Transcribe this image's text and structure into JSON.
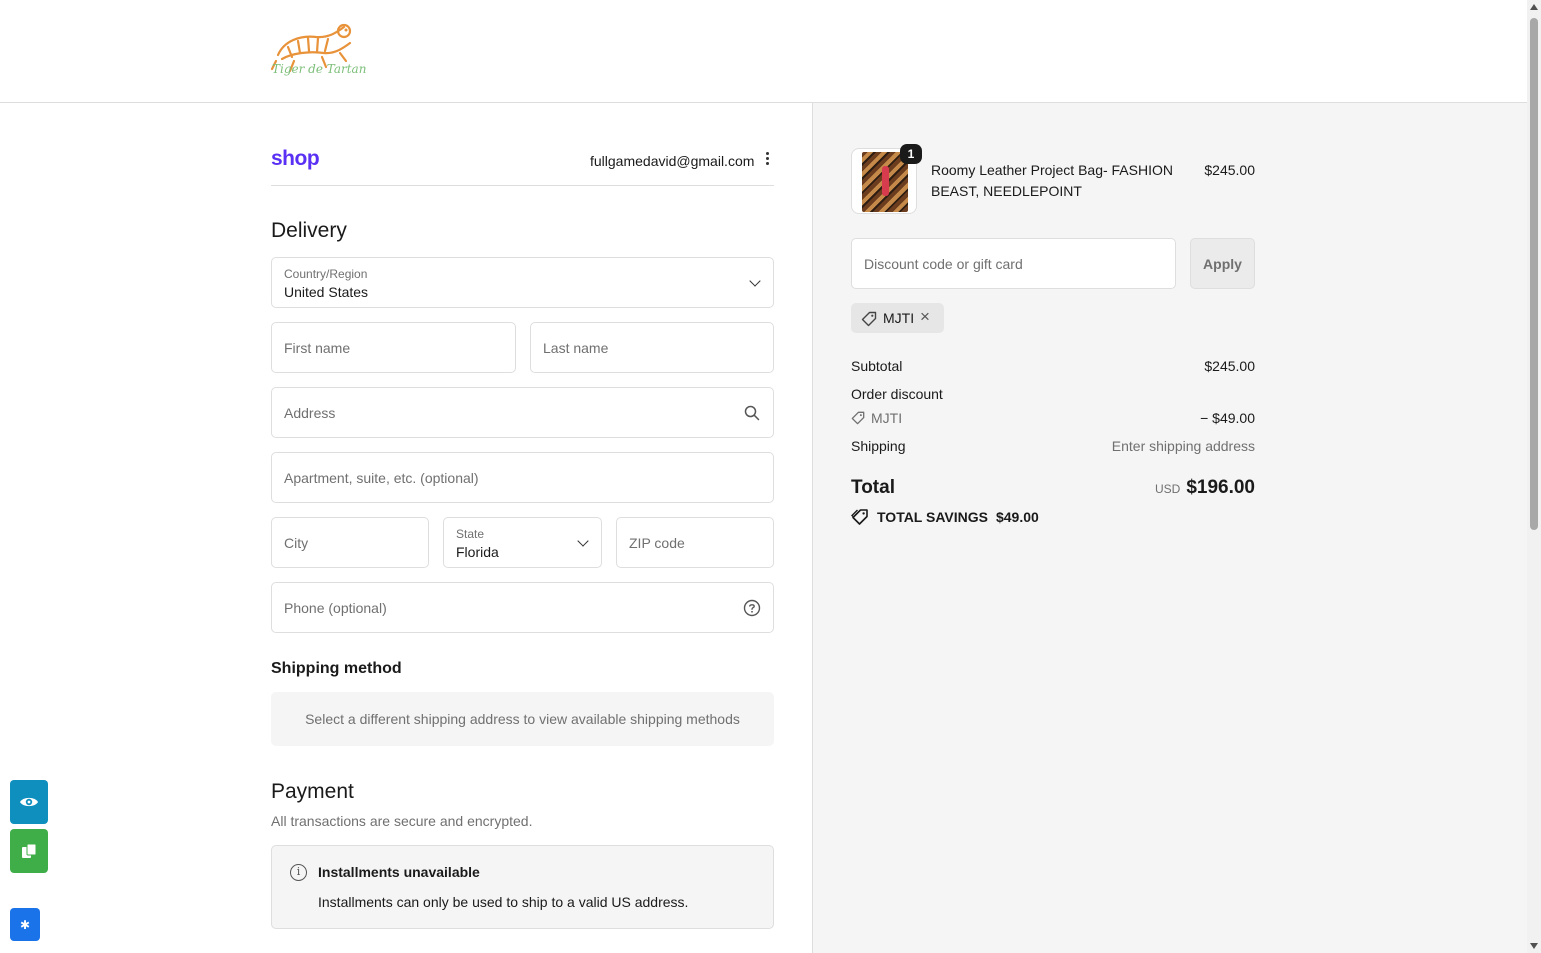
{
  "header": {
    "logo_text": "Tiger de Tartan"
  },
  "account": {
    "shop_logo": "shop",
    "email": "fullgamedavid@gmail.com"
  },
  "delivery": {
    "title": "Delivery",
    "country_label": "Country/Region",
    "country_value": "United States",
    "first_name_placeholder": "First name",
    "last_name_placeholder": "Last name",
    "address_placeholder": "Address",
    "apartment_placeholder": "Apartment, suite, etc. (optional)",
    "city_placeholder": "City",
    "state_label": "State",
    "state_value": "Florida",
    "zip_placeholder": "ZIP code",
    "phone_placeholder": "Phone (optional)"
  },
  "shipping_method": {
    "title": "Shipping method",
    "note": "Select a different shipping address to view available shipping methods"
  },
  "payment": {
    "title": "Payment",
    "subtitle": "All transactions are secure and encrypted.",
    "notice_title": "Installments unavailable",
    "notice_text": "Installments can only be used to ship to a valid US address."
  },
  "order": {
    "item": {
      "quantity": "1",
      "name": "Roomy Leather Project Bag- FASHION BEAST, NEEDLEPOINT",
      "price": "$245.00"
    },
    "discount_placeholder": "Discount code or gift card",
    "apply_label": "Apply",
    "applied_code": "MJTI",
    "subtotal_label": "Subtotal",
    "subtotal_value": "$245.00",
    "order_discount_label": "Order discount",
    "discount_code": "MJTI",
    "discount_value": "− $49.00",
    "shipping_label": "Shipping",
    "shipping_value": "Enter shipping address",
    "total_label": "Total",
    "currency": "USD",
    "total_value": "$196.00",
    "savings_label": "TOTAL SAVINGS",
    "savings_value": "$49.00"
  },
  "colors": {
    "shop_brand": "#5a31f4",
    "fab_eye": "#0e8fbd",
    "fab_copy": "#3fae49",
    "fab_gear": "#1a73e8"
  },
  "icons": [
    "tiger-logo-icon",
    "kebab-menu-icon",
    "chevron-down-icon",
    "search-icon",
    "help-circle-icon",
    "info-icon",
    "tag-icon",
    "close-icon",
    "eye-icon",
    "copy-icon",
    "gear-icon"
  ]
}
